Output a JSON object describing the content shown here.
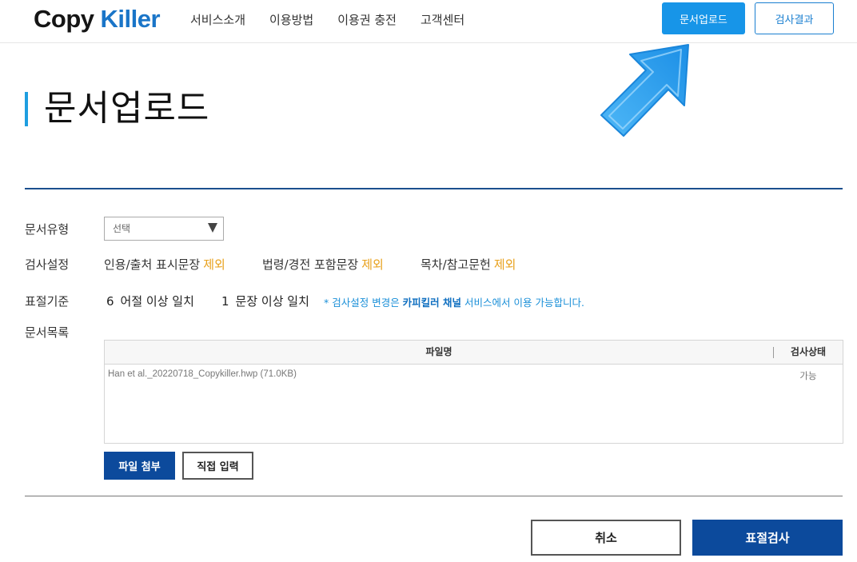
{
  "header": {
    "logo_word1": "Copy",
    "logo_word2": "Killer",
    "nav": [
      "서비스소개",
      "이용방법",
      "이용권 충전",
      "고객센터"
    ],
    "upload_button": "문서업로드",
    "results_button": "검사결과"
  },
  "page": {
    "title": "문서업로드"
  },
  "form": {
    "doc_type_label": "문서유형",
    "doc_type_selected": "선택",
    "check_settings_label": "검사설정",
    "check_options": [
      {
        "text": "인용/출처 표시문장",
        "state": "제외"
      },
      {
        "text": "법령/경전 포함문장",
        "state": "제외"
      },
      {
        "text": "목차/참고문헌",
        "state": "제외"
      }
    ],
    "criteria_label": "표절기준",
    "criteria": [
      {
        "number": "6",
        "text": "어절 이상 일치"
      },
      {
        "number": "1",
        "text": "문장 이상 일치"
      }
    ],
    "note_prefix": "* 검사설정 변경은 ",
    "note_emphasis": "카피킬러 채널",
    "note_suffix": " 서비스에서 이용 가능합니다.",
    "doc_list_label": "문서목록"
  },
  "file_table": {
    "columns": [
      "파일명",
      "검사상태"
    ],
    "rows": [
      {
        "name": "Han et al._20220718_Copykiller.hwp (71.0KB)",
        "status": "가능"
      }
    ]
  },
  "buttons": {
    "attach": "파일 첨부",
    "direct_input": "직접 입력",
    "cancel": "취소",
    "check": "표절검사"
  },
  "colors": {
    "accent_blue": "#1795e8",
    "navy": "#0c4a9c",
    "exclude_orange": "#e8a11c",
    "arrow_blue": "#3aa9f2"
  }
}
